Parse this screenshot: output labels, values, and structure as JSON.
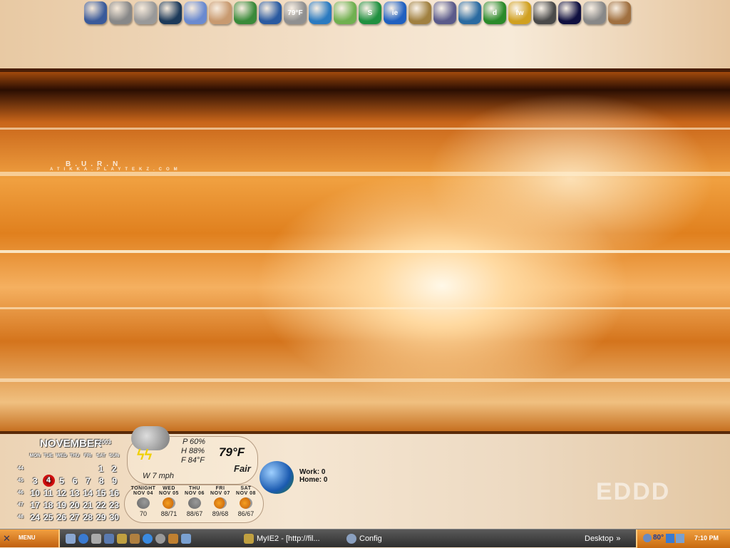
{
  "wallpaper": {
    "logo": "B.U.R.N",
    "site": "ATIKKA.PLAYTEKZ.COM",
    "corner_logo": "EDDD"
  },
  "dock": {
    "items": [
      {
        "name": "my-computer",
        "color": "#3a5a9a",
        "label": ""
      },
      {
        "name": "recycle",
        "color": "#888888",
        "label": ""
      },
      {
        "name": "mail",
        "color": "#999999",
        "label": ""
      },
      {
        "name": "database",
        "color": "#1d3a5a",
        "label": ""
      },
      {
        "name": "photos",
        "color": "#6a8ad0",
        "label": ""
      },
      {
        "name": "package",
        "color": "#c89a70",
        "label": ""
      },
      {
        "name": "network",
        "color": "#3a8a3a",
        "label": ""
      },
      {
        "name": "paint",
        "color": "#2a5aa0",
        "label": ""
      },
      {
        "name": "weather",
        "color": "#909090",
        "label": "79°F"
      },
      {
        "name": "safari",
        "color": "#2a7ac0",
        "label": ""
      },
      {
        "name": "itunes",
        "color": "#70b050",
        "label": ""
      },
      {
        "name": "s-app",
        "color": "#209040",
        "label": "S"
      },
      {
        "name": "internet-explorer",
        "color": "#2060c0",
        "label": "ie"
      },
      {
        "name": "keys",
        "color": "#a08040",
        "label": ""
      },
      {
        "name": "player",
        "color": "#5a5a8a",
        "label": ""
      },
      {
        "name": "tools",
        "color": "#2a6aa0",
        "label": ""
      },
      {
        "name": "dreamweaver",
        "color": "#2a8a2a",
        "label": "d"
      },
      {
        "name": "fireworks",
        "color": "#d0a020",
        "label": "fw"
      },
      {
        "name": "contacts",
        "color": "#4a4a4a",
        "label": ""
      },
      {
        "name": "terminal",
        "color": "#101040",
        "label": ""
      },
      {
        "name": "calculator",
        "color": "#888888",
        "label": ""
      },
      {
        "name": "clipboard",
        "color": "#a07040",
        "label": ""
      }
    ]
  },
  "calendar": {
    "month": "NOVEMBER",
    "year": "2003",
    "weekdays": [
      "MON",
      "TUE",
      "WED",
      "THU",
      "FRI",
      "SAT",
      "SUN"
    ],
    "weeks": [
      {
        "num": "44",
        "days": [
          "",
          "",
          "",
          "",
          "",
          "1",
          "2"
        ]
      },
      {
        "num": "45",
        "days": [
          "3",
          "4",
          "5",
          "6",
          "7",
          "8",
          "9"
        ]
      },
      {
        "num": "46",
        "days": [
          "10",
          "11",
          "12",
          "13",
          "14",
          "15",
          "16"
        ]
      },
      {
        "num": "47",
        "days": [
          "17",
          "18",
          "19",
          "20",
          "21",
          "22",
          "23"
        ]
      },
      {
        "num": "48",
        "days": [
          "24",
          "25",
          "26",
          "27",
          "28",
          "29",
          "30"
        ]
      }
    ],
    "today": "4"
  },
  "weather": {
    "precip": "P 60%",
    "humidity": "H 88%",
    "feels": "F 84°F",
    "temp": "79°F",
    "condition": "Fair",
    "wind": "W  7 mph",
    "forecast": [
      {
        "day": "TONIGHT",
        "date": "NOV 04",
        "temp": "70",
        "icon": "storm"
      },
      {
        "day": "WED",
        "date": "NOV 05",
        "temp": "88/71",
        "icon": "sun"
      },
      {
        "day": "THU",
        "date": "NOV 06",
        "temp": "88/67",
        "icon": "storm"
      },
      {
        "day": "FRI",
        "date": "NOV 07",
        "temp": "89/68",
        "icon": "sun"
      },
      {
        "day": "SAT",
        "date": "NOV 08",
        "temp": "86/67",
        "icon": "sun"
      }
    ]
  },
  "mail": {
    "work": "Work: 0",
    "home": "Home: 0"
  },
  "taskbar": {
    "menu": "MENU",
    "tasks": [
      "MyIE2 - [http://fil...",
      "Config"
    ],
    "desktop": "Desktop",
    "tray_temp": "80°",
    "clock": "7:10 PM"
  }
}
